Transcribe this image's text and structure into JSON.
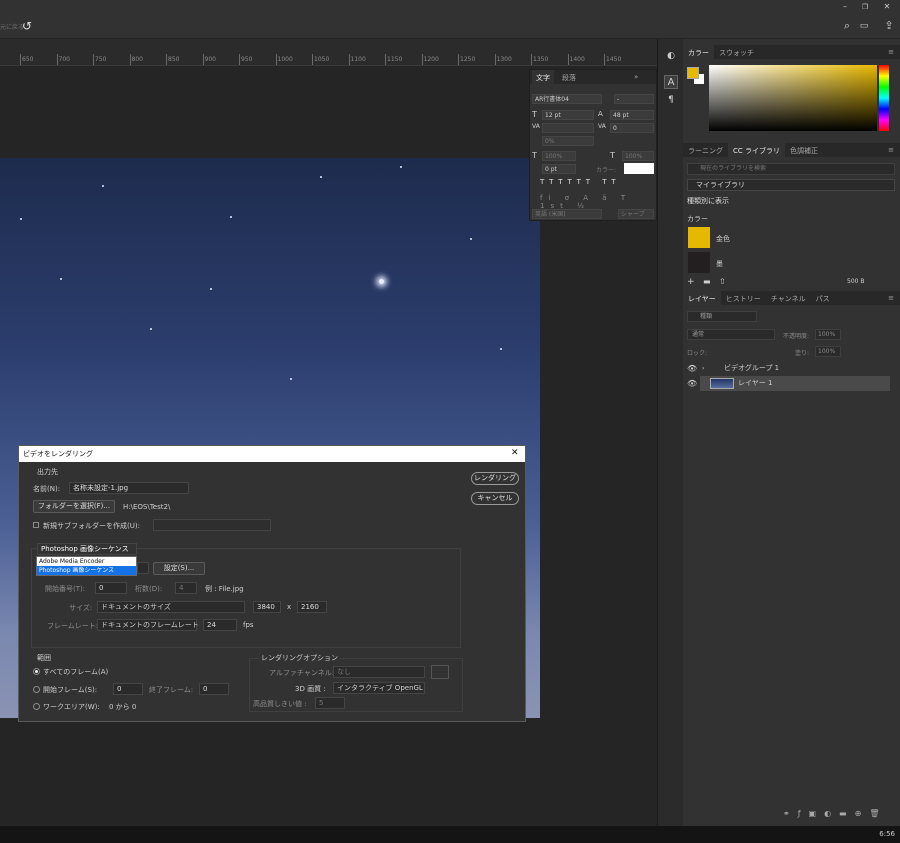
{
  "app": {
    "titlebar": {
      "icons": [
        "minimize-icon",
        "restore-icon",
        "close-icon"
      ]
    },
    "options": {
      "left_label": "元に戻る",
      "undo_icon": "undo-icon"
    },
    "ruler_ticks": [
      "650",
      "700",
      "750",
      "800",
      "850",
      "900",
      "950",
      "1000",
      "1050",
      "1100",
      "1150",
      "1200",
      "1250",
      "1300",
      "1350",
      "1400",
      "1450"
    ],
    "clock": "6:56"
  },
  "character_panel": {
    "tabs": [
      "文字",
      "段落"
    ],
    "font_family": "AR行書体04",
    "font_style": "-",
    "font_size": "12 pt",
    "leading": "48 pt",
    "kerning": "",
    "tracking": "0",
    "tsume": "0%",
    "vscale": "100%",
    "hscale": "100%",
    "baseline": "0 pt",
    "color_label": "カラー:",
    "language": "英語 (米国)",
    "antialias": "シャープ"
  },
  "color_panel": {
    "tabs": [
      "カラー",
      "スウォッチ"
    ],
    "fg": "#e7b800",
    "bg": "#ffffff",
    "picker_hue": "#e7b800"
  },
  "library_panel": {
    "tabs": [
      "ラーニング",
      "CC ライブラリ",
      "色調補正"
    ],
    "search_placeholder": "現在のライブラリを検索",
    "library_name": "マイライブラリ",
    "view_label": "種類別に表示",
    "section": "カラー",
    "swatches": [
      {
        "name": "金色",
        "color": "#e7b800"
      },
      {
        "name": "墨",
        "color": "#231f20"
      }
    ],
    "storage": "500 B"
  },
  "layers_panel": {
    "tabs": [
      "レイヤー",
      "ヒストリー",
      "チャンネル",
      "パス"
    ],
    "filter_label": "種類",
    "blend_mode": "通常",
    "opacity_label": "不透明度:",
    "opacity": "100%",
    "lock_label": "ロック:",
    "fill_label": "塗り:",
    "fill": "100%",
    "layers": [
      {
        "name": "ビデオグループ 1"
      },
      {
        "name": "レイヤー 1"
      }
    ]
  },
  "dialog": {
    "title": "ビデオをレンダリング",
    "output_section": "出力先",
    "name_label": "名前(N):",
    "name_value": "名称未設定-1.jpg",
    "choose_folder": "フォルダーを選択(F)...",
    "folder_path": "H:\\EOS\\Test2\\",
    "new_subfolder": "新規サブフォルダーを作成(U):",
    "render_button": "レンダリング",
    "cancel_button": "キャンセル",
    "format_select": "Photoshop 画像シーケンス",
    "format_options": [
      "Adobe Media Encoder",
      "Photoshop 画像シーケンス"
    ],
    "settings_button": "設定(S)...",
    "start_number_label": "開始番号(T):",
    "start_number": "0",
    "digits_label": "桁数(D):",
    "digits": "4",
    "example": "例 : File.jpg",
    "size_label": "サイズ:",
    "size_select": "ドキュメントのサイズ",
    "width": "3840",
    "x": "x",
    "height": "2160",
    "framerate_label": "フレームレート:",
    "framerate_select": "ドキュメントのフレームレート",
    "fps_value": "24",
    "fps_unit": "fps",
    "range_section": "範囲",
    "all_frames": "すべてのフレーム(A)",
    "start_frame_label": "開始フレーム(S):",
    "start_frame": "0",
    "end_frame_label": "終了フレーム:",
    "end_frame": "0",
    "work_area": "ワークエリア(W):",
    "work_area_value": "0 から 0",
    "render_options": "レンダリングオプション",
    "alpha_label": "アルファチャンネル:",
    "alpha_value": "なし",
    "quality_label": "3D 画質 :",
    "quality_value": "インタラクティブ OpenGL",
    "threshold_label": "高品質しきい値 :",
    "threshold_value": "5"
  }
}
